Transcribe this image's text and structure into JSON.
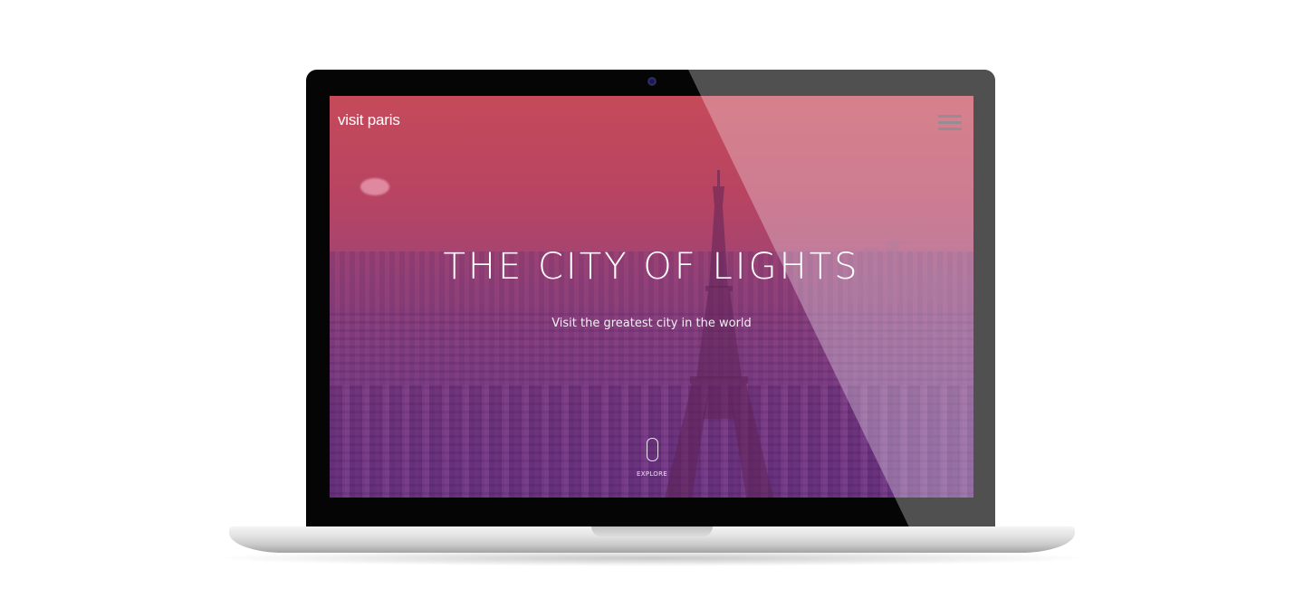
{
  "site": {
    "brand": "visit paris",
    "menu_icon": "hamburger-menu-icon"
  },
  "hero": {
    "headline": "THE CITY OF LIGHTS",
    "subline": "Visit the greatest city in the world",
    "explore_label": "EXPLORE",
    "explore_icon": "mouse-scroll-icon"
  },
  "colors": {
    "gradient_top": "#c54a5a",
    "gradient_bottom": "#733a8a",
    "text": "#ffffff",
    "menu_icon": "#6d5a66"
  }
}
